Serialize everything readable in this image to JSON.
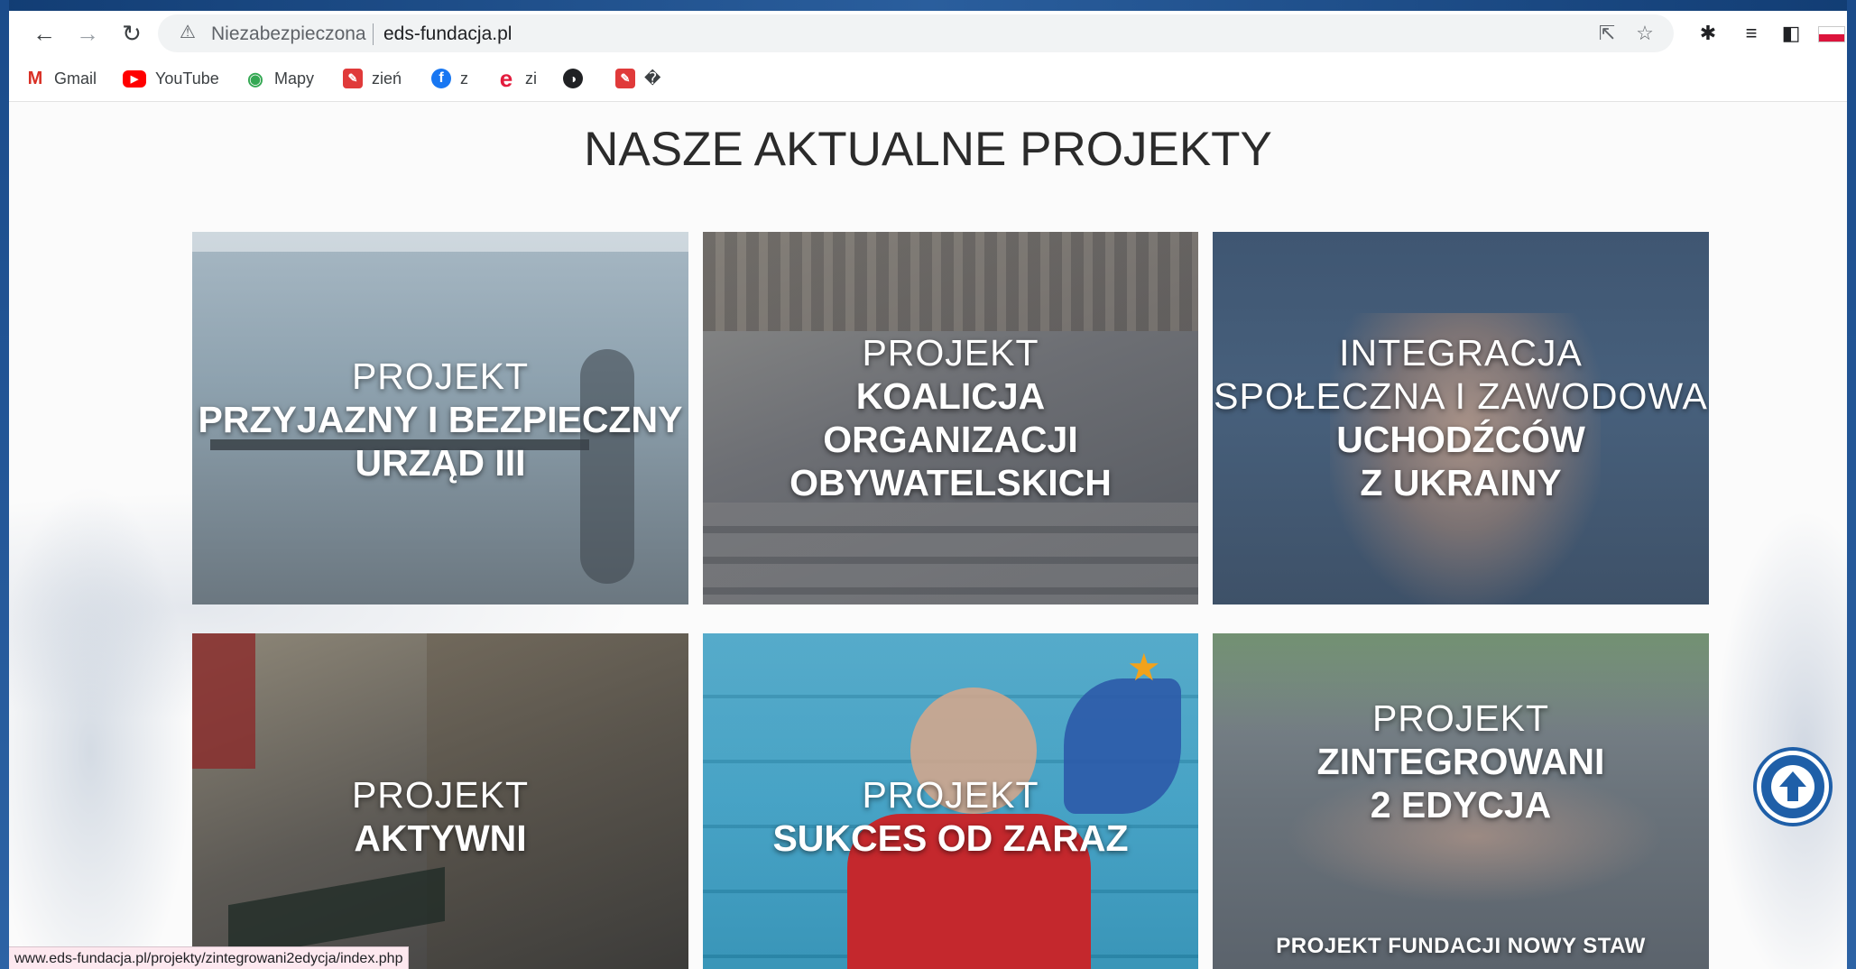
{
  "browser": {
    "security_label": "Niezabezpieczona",
    "url": "eds-fundacja.pl",
    "icons": [
      "back-icon",
      "forward-icon",
      "reload-icon",
      "warning-icon",
      "share-icon",
      "star-icon",
      "extensions-icon",
      "reading-list-icon",
      "side-panel-icon",
      "profile-flag-icon"
    ]
  },
  "bookmarks": [
    {
      "label": "Gmail",
      "icon": "gmail-icon"
    },
    {
      "label": "YouTube",
      "icon": "youtube-icon"
    },
    {
      "label": "Mapy",
      "icon": "maps-icon"
    },
    {
      "label": "zień",
      "icon": "red-bookmark-icon"
    },
    {
      "label": "z",
      "icon": "facebook-icon"
    },
    {
      "label": "zi",
      "icon": "e-icon"
    },
    {
      "label": "",
      "icon": "globe-icon"
    },
    {
      "label": "�",
      "icon": "red-bookmark-icon"
    }
  ],
  "page": {
    "title": "NASZE AKTUALNE PROJEKTY",
    "cards": [
      {
        "line1": "PROJEKT",
        "line2": "PRZYJAZNY I BEZPIECZNY",
        "line3": "URZĄD III"
      },
      {
        "line1": "PROJEKT",
        "line2": "KOALICJA",
        "line3": "ORGANIZACJI",
        "line4": "OBYWATELSKICH"
      },
      {
        "line1": "INTEGRACJA",
        "line2": "SPOŁECZNA I ZAWODOWA",
        "line3": "UCHODŹCÓW",
        "line4": "Z UKRAINY"
      },
      {
        "line1": "PROJEKT",
        "line2": "AKTYWNI"
      },
      {
        "line1": "PROJEKT",
        "line2": "SUKCES OD ZARAZ"
      },
      {
        "line1": "PROJEKT",
        "line2": "ZINTEGROWANI",
        "line3": "2 EDYCJA",
        "footer": "PROJEKT FUNDACJI NOWY STAW"
      }
    ]
  },
  "status_bar": {
    "text": "www.eds-fundacja.pl/projekty/zintegrowani2edycja/index.php"
  },
  "colors": {
    "accent": "#1f5fa8",
    "frame": "#1f4a86"
  }
}
